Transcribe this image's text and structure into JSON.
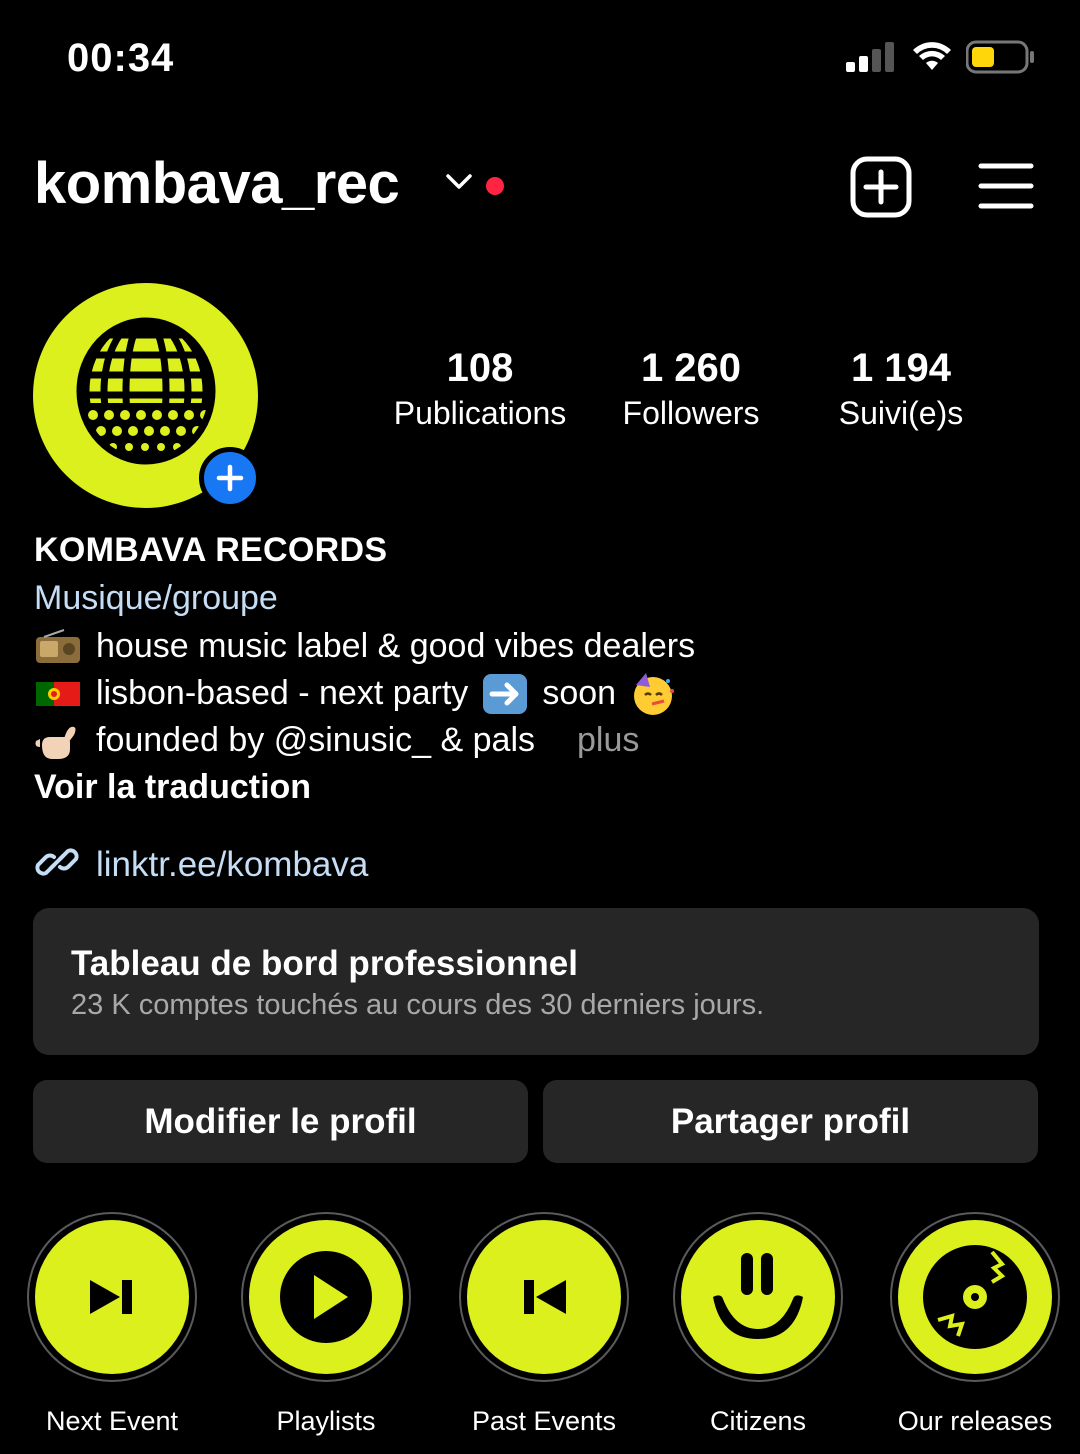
{
  "status_bar": {
    "time": "00:34"
  },
  "header": {
    "username": "kombava_rec"
  },
  "stats": [
    {
      "value": "108",
      "label": "Publications"
    },
    {
      "value": "1 260",
      "label": "Followers"
    },
    {
      "value": "1 194",
      "label": "Suivi(e)s"
    }
  ],
  "bio": {
    "display_name": "KOMBAVA RECORDS",
    "category": "Musique/groupe",
    "lines": [
      "house music label & good vibes dealers",
      "lisbon-based - next party",
      "soon",
      "founded by @sinusic_ & pals"
    ],
    "more_label": "plus",
    "translate_label": "Voir la traduction",
    "link": "linktr.ee/kombava"
  },
  "dashboard": {
    "title": "Tableau de bord professionnel",
    "subtitle": "23 K comptes touchés au cours des 30 derniers jours."
  },
  "buttons": {
    "edit": "Modifier le profil",
    "share": "Partager profil"
  },
  "highlights": [
    {
      "label": "Next Event",
      "icon": "next-icon"
    },
    {
      "label": "Playlists",
      "icon": "play-icon"
    },
    {
      "label": "Past Events",
      "icon": "previous-icon"
    },
    {
      "label": "Citizens",
      "icon": "smiley-icon"
    },
    {
      "label": "Our releases",
      "icon": "vinyl-icon"
    }
  ],
  "colors": {
    "accent": "#dcf01d",
    "link": "#c5ddf5",
    "surface": "#262626",
    "badge": "#ff2442",
    "blue": "#1877f2"
  }
}
